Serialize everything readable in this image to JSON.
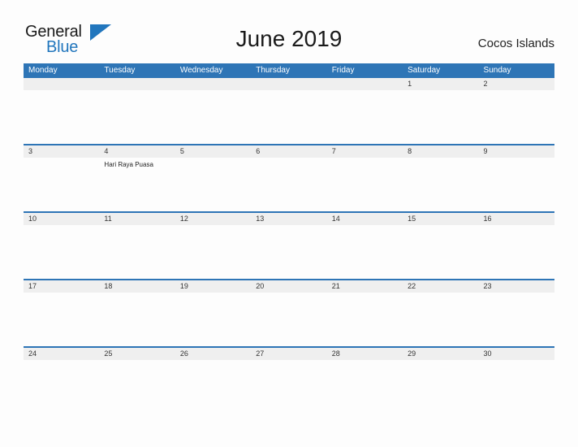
{
  "header": {
    "logo": {
      "word_one": "General",
      "word_two": "Blue",
      "flag_icon": "triangle-flag-icon",
      "color_dark": "#1a1a1a",
      "color_blue": "#2176bd"
    },
    "title": "June 2019",
    "location": "Cocos Islands"
  },
  "calendar": {
    "colors": {
      "header_blue": "#2e75b6",
      "row_stripe": "#efefef",
      "divider_blue": "#2e75b6",
      "page_background": "#fdfdfd"
    },
    "weekdays": [
      "Monday",
      "Tuesday",
      "Wednesday",
      "Thursday",
      "Friday",
      "Saturday",
      "Sunday"
    ],
    "weeks": [
      {
        "days": [
          {
            "date": "",
            "events": []
          },
          {
            "date": "",
            "events": []
          },
          {
            "date": "",
            "events": []
          },
          {
            "date": "",
            "events": []
          },
          {
            "date": "",
            "events": []
          },
          {
            "date": "1",
            "events": []
          },
          {
            "date": "2",
            "events": []
          }
        ]
      },
      {
        "days": [
          {
            "date": "3",
            "events": []
          },
          {
            "date": "4",
            "events": [
              "Hari Raya Puasa"
            ]
          },
          {
            "date": "5",
            "events": []
          },
          {
            "date": "6",
            "events": []
          },
          {
            "date": "7",
            "events": []
          },
          {
            "date": "8",
            "events": []
          },
          {
            "date": "9",
            "events": []
          }
        ]
      },
      {
        "days": [
          {
            "date": "10",
            "events": []
          },
          {
            "date": "11",
            "events": []
          },
          {
            "date": "12",
            "events": []
          },
          {
            "date": "13",
            "events": []
          },
          {
            "date": "14",
            "events": []
          },
          {
            "date": "15",
            "events": []
          },
          {
            "date": "16",
            "events": []
          }
        ]
      },
      {
        "days": [
          {
            "date": "17",
            "events": []
          },
          {
            "date": "18",
            "events": []
          },
          {
            "date": "19",
            "events": []
          },
          {
            "date": "20",
            "events": []
          },
          {
            "date": "21",
            "events": []
          },
          {
            "date": "22",
            "events": []
          },
          {
            "date": "23",
            "events": []
          }
        ]
      },
      {
        "days": [
          {
            "date": "24",
            "events": []
          },
          {
            "date": "25",
            "events": []
          },
          {
            "date": "26",
            "events": []
          },
          {
            "date": "27",
            "events": []
          },
          {
            "date": "28",
            "events": []
          },
          {
            "date": "29",
            "events": []
          },
          {
            "date": "30",
            "events": []
          }
        ]
      }
    ]
  }
}
